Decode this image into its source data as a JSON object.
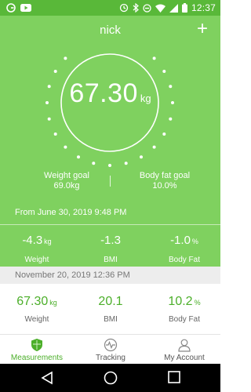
{
  "status_bar": {
    "time": "12:37"
  },
  "header": {
    "profile_name": "nick",
    "add_label": "+"
  },
  "current": {
    "weight": "67.30",
    "unit": "kg"
  },
  "goals": {
    "weight_goal_label": "Weight goal",
    "weight_goal_value": "69.0kg",
    "body_fat_goal_label": "Body fat goal",
    "body_fat_goal_value": "10.0%"
  },
  "change": {
    "from_text": "From June 30, 2019 9:48 PM",
    "weight_value": "-4.3",
    "weight_unit": "kg",
    "weight_label": "Weight",
    "bmi_value": "-1.3",
    "bmi_label": "BMI",
    "fat_value": "-1.0",
    "fat_unit": "%",
    "fat_label": "Body Fat"
  },
  "latest": {
    "date": "November 20, 2019 12:36 PM",
    "weight_value": "67.30",
    "weight_unit": "kg",
    "weight_label": "Weight",
    "bmi_value": "20.1",
    "bmi_label": "BMI",
    "fat_value": "10.2",
    "fat_unit": "%",
    "fat_label": "Body Fat"
  },
  "tabs": [
    {
      "label": "Measurements",
      "icon": "shield-icon",
      "active": true
    },
    {
      "label": "Tracking",
      "icon": "pulse-icon",
      "active": false
    },
    {
      "label": "My Account",
      "icon": "person-icon",
      "active": false
    }
  ],
  "colors": {
    "accent": "#7fd15f",
    "status_bar": "#59b839",
    "value_green": "#4caf2a"
  }
}
